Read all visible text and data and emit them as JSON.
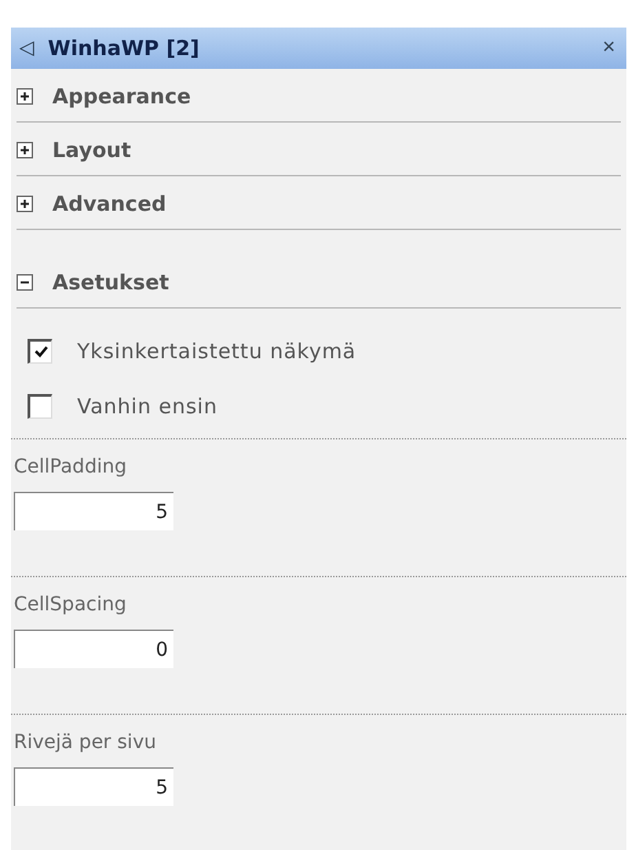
{
  "panel": {
    "title": "WinhaWP [2]",
    "collapse_glyph": "◁",
    "close_glyph": "×"
  },
  "sections": [
    {
      "label": "Appearance",
      "expanded": false
    },
    {
      "label": "Layout",
      "expanded": false
    },
    {
      "label": "Advanced",
      "expanded": false
    },
    {
      "label": "Asetukset",
      "expanded": true
    }
  ],
  "options": [
    {
      "label": "Yksinkertaistettu näkymä",
      "checked": true
    },
    {
      "label": "Vanhin ensin",
      "checked": false
    }
  ],
  "fields": [
    {
      "label": "CellPadding",
      "value": "5"
    },
    {
      "label": "CellSpacing",
      "value": "0"
    },
    {
      "label": "Rivejä per sivu",
      "value": "5"
    }
  ]
}
